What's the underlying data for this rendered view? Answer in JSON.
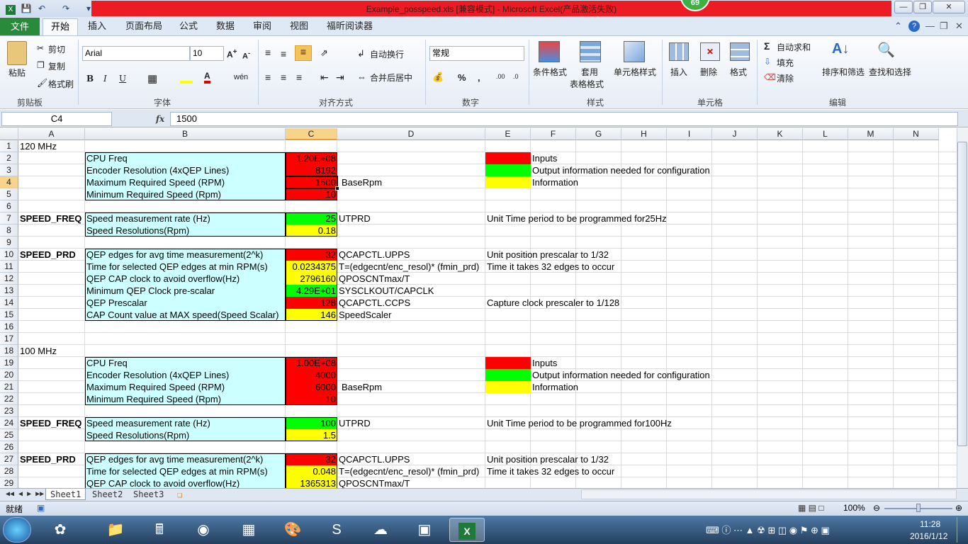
{
  "window": {
    "title": "Example_posspeed.xls  [兼容模式] - Microsoft Excel(产品激活失败)",
    "badge": "69"
  },
  "ribbon": {
    "file_tab": "文件",
    "tabs": [
      "开始",
      "插入",
      "页面布局",
      "公式",
      "数据",
      "审阅",
      "视图",
      "福昕阅读器"
    ],
    "clipboard": {
      "paste": "粘贴",
      "cut": "剪切",
      "copy": "复制",
      "format_painter": "格式刷",
      "group": "剪贴板"
    },
    "font": {
      "name": "Arial",
      "size": "10",
      "group": "字体"
    },
    "alignment": {
      "wrap": "自动换行",
      "merge": "合并后居中",
      "group": "对齐方式"
    },
    "number": {
      "format": "常规",
      "group": "数字"
    },
    "styles": {
      "conditional": "条件格式",
      "table1": "套用",
      "table2": "表格格式",
      "cell_styles": "单元格样式",
      "group": "样式"
    },
    "cells": {
      "insert": "插入",
      "delete": "删除",
      "format": "格式",
      "group": "单元格"
    },
    "editing": {
      "autosum": "自动求和",
      "fill": "填充",
      "clear": "清除",
      "sort": "排序和筛选",
      "find": "查找和选择",
      "group": "编辑"
    }
  },
  "formula_bar": {
    "name_box": "C4",
    "fx": "fx",
    "value": "1500"
  },
  "columns": [
    "A",
    "B",
    "C",
    "D",
    "E",
    "F",
    "G",
    "H",
    "I",
    "J",
    "K",
    "L",
    "M",
    "N"
  ],
  "rows": [
    "1",
    "2",
    "3",
    "4",
    "5",
    "6",
    "7",
    "8",
    "9",
    "10",
    "11",
    "12",
    "13",
    "14",
    "15",
    "16",
    "17",
    "18",
    "19",
    "20",
    "21",
    "22",
    "23",
    "24",
    "25",
    "26",
    "27",
    "28",
    "29"
  ],
  "cells": {
    "A1": "120 MHz",
    "B2": "CPU Freq",
    "C2": "1.20E+08",
    "B3": "Encoder Resolution (4xQEP Lines)",
    "C3": "8192",
    "B4": "Maximum Required Speed (RPM)",
    "C4": "1500",
    "D4": "BaseRpm",
    "B5": "Minimum Required Speed (Rpm)",
    "C5": "10",
    "E2_legend": "Inputs",
    "E3_legend": "Output information needed for configuration",
    "E4_legend": "Information",
    "A7": "SPEED_FREQ",
    "B7": "Speed measurement rate (Hz)",
    "C7": "25",
    "D7": "UTPRD",
    "E7": "Unit Time period to be programmed for25Hz",
    "B8": "Speed Resolutions(Rpm)",
    "C8": "0.18",
    "A10": "SPEED_PRD",
    "B10": "QEP edges for avg time measurement(2^k)",
    "C10": "32",
    "D10": "QCAPCTL.UPPS",
    "E10": "Unit position prescalar to 1/32",
    "B11": "Time for selected QEP edges at min RPM(s)",
    "C11": "0.0234375",
    "D11": "T=(edgecnt/enc_resol)* (fmin_prd)",
    "E11": "Time it takes 32 edges to occur",
    "B12": "QEP CAP clock to avoid overflow(Hz)",
    "C12": "2796160",
    "D12": "QPOSCNTmax/T",
    "B13": "Minimum QEP Clock pre-scalar",
    "C13": "4.29E+01",
    "D13": "SYSCLKOUT/CAPCLK",
    "B14": "QEP Prescalar",
    "C14": "128",
    "D14": "QCAPCTL.CCPS",
    "E14": "Capture clock prescaler to 1/128",
    "B15": "CAP Count value at MAX speed(Speed Scalar)",
    "C15": "146",
    "D15": "SpeedScaler",
    "A18": "100 MHz",
    "B19": "CPU Freq",
    "C19": "1.00E+08",
    "B20": "Encoder Resolution (4xQEP Lines)",
    "C20": "4000",
    "B21": "Maximum Required Speed (RPM)",
    "C21": "6000",
    "D21": "BaseRpm",
    "B22": "Minimum Required Speed (Rpm)",
    "C22": "10",
    "E19_legend": "Inputs",
    "E20_legend": "Output information needed for configuration",
    "E21_legend": "Information",
    "A24": "SPEED_FREQ",
    "B24": "Speed measurement rate (Hz)",
    "C24": "100",
    "D24": "UTPRD",
    "E24": "Unit Time period to be programmed for100Hz",
    "B25": "Speed Resolutions(Rpm)",
    "C25": "1.5",
    "A27": "SPEED_PRD",
    "B27": "QEP edges for avg time measurement(2^k)",
    "C27": "32",
    "D27": "QCAPCTL.UPPS",
    "E27": "Unit position prescalar to 1/32",
    "B28": "Time for selected QEP edges at min RPM(s)",
    "C28": "0.048",
    "D28": "T=(edgecnt/enc_resol)* (fmin_prd)",
    "E28": "Time it takes 32 edges to occur",
    "B29": "QEP CAP clock to avoid overflow(Hz)",
    "C29": "1365313",
    "D29": "QPOSCNTmax/T"
  },
  "sheets": [
    "Sheet1",
    "Sheet2",
    "Sheet3"
  ],
  "status": {
    "ready": "就绪",
    "zoom": "100%"
  },
  "taskbar": {
    "time": "11:28",
    "date": "2016/1/12"
  },
  "colors": {
    "input": "#ff0000",
    "output": "#00ff00",
    "info": "#ffff00",
    "label": "#ccffff"
  }
}
